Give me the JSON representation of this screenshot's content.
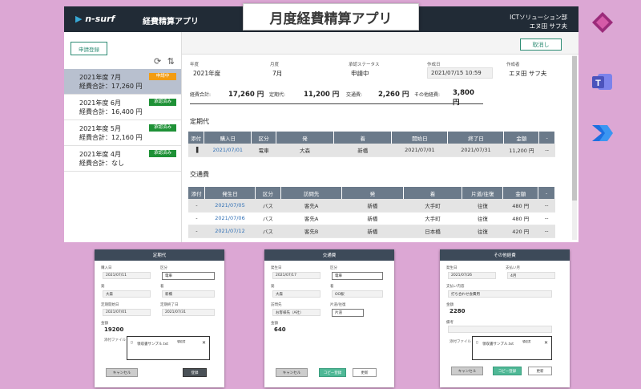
{
  "banner": "月度経費精算アプリ",
  "header": {
    "logo_a": "n-",
    "logo_b": "surf",
    "title": "経費精算アプリ",
    "org": "ICTソリューション部",
    "user": "エヌ田 サフ夫"
  },
  "sidebar": {
    "request_label": "申請登録",
    "refresh": "⟳",
    "sort": "⇅",
    "items": [
      {
        "title": "2021年度 7月",
        "total": "経費合計：17,260 円",
        "badge": "申請中",
        "color": "#f39c12"
      },
      {
        "title": "2021年度 6月",
        "total": "経費合計：16,400 円",
        "badge": "承認済み",
        "color": "#1e9136"
      },
      {
        "title": "2021年度 5月",
        "total": "経費合計：12,160 円",
        "badge": "承認済み",
        "color": "#1e9136"
      },
      {
        "title": "2021年度 4月",
        "total": "経費合計：なし",
        "badge": "承認済み",
        "color": "#1e9136"
      }
    ]
  },
  "detail": {
    "cancel": "取消し",
    "fields": {
      "year_l": "年度",
      "year": "2021年度",
      "month_l": "月度",
      "month": "7月",
      "status_l": "承認ステータス",
      "status": "申請中",
      "created_l": "作成日",
      "created": "2021/07/15 10:59",
      "author_l": "作成者",
      "author": "エヌ田 サフ夫"
    },
    "summary": {
      "total_l": "経費合計:",
      "total": "17,260 円",
      "commuter_l": "定期代:",
      "commuter": "11,200 円",
      "transport_l": "交通費:",
      "transport": "2,260 円",
      "other_l": "その他経費:",
      "other": "3,800 円"
    },
    "commuter_title": "定期代",
    "commuter_cols": [
      "添付",
      "購入日",
      "区分",
      "発",
      "着",
      "開始日",
      "終了日",
      "金額",
      "-"
    ],
    "commuter_rows": [
      [
        "▐",
        "2021/07/01",
        "電車",
        "大森",
        "新橋",
        "2021/07/01",
        "2021/07/31",
        "11,200 円",
        "--"
      ]
    ],
    "transport_title": "交通費",
    "transport_cols": [
      "添付",
      "発生日",
      "区分",
      "訪問先",
      "発",
      "着",
      "片道/往復",
      "金額",
      "-"
    ],
    "transport_rows": [
      [
        "-",
        "2021/07/05",
        "バス",
        "客先A",
        "新橋",
        "大手町",
        "往復",
        "480 円",
        "--"
      ],
      [
        "-",
        "2021/07/06",
        "バス",
        "客先A",
        "新橋",
        "大手町",
        "往復",
        "480 円",
        "--"
      ],
      [
        "-",
        "2021/07/12",
        "バス",
        "客先B",
        "新橋",
        "日本橋",
        "往復",
        "420 円",
        "--"
      ]
    ]
  },
  "dialog1": {
    "title": "定期代",
    "date_l": "購入日",
    "date": "2021/07/11",
    "kind_l": "区分",
    "kind": "電車",
    "from_l": "発",
    "from": "大森",
    "to_l": "着",
    "to": "新橋",
    "start_l": "定期開始日",
    "start": "2021/07/01",
    "end_l": "定期終了日",
    "end": "2021/07/31",
    "amt_l": "金額",
    "amt": "19200",
    "file_l": "添付ファイル",
    "file": "領収書サンプル.txt",
    "file_tag": "領収書",
    "cancel": "キャンセル",
    "save": "登録"
  },
  "dialog2": {
    "title": "交通費",
    "date_l": "発生日",
    "date": "2021/07/17",
    "kind_l": "区分",
    "kind": "電車",
    "from_l": "発",
    "from": "大森",
    "to_l": "着",
    "to": "OO駅",
    "visit_l": "訪問先",
    "visit": "お客様先（A社）",
    "way_l": "片道/往復",
    "way": "片道",
    "amt_l": "金額",
    "amt": "640",
    "cancel": "キャンセル",
    "copy": "コピー登録",
    "update": "更新"
  },
  "dialog3": {
    "title": "その他経費",
    "date_l": "発生日",
    "date": "2021/07/26",
    "pay_l": "支払い月",
    "pay": "4月",
    "content_l": "支払い内容",
    "content": "打ち合わせ会費用",
    "amt_l": "金額",
    "amt": "2280",
    "note_l": "備考",
    "note": "",
    "file_l": "添付ファイル",
    "file": "領収書サンプル.txt",
    "file_tag": "領収書",
    "cancel": "キャンセル",
    "copy": "コピー登録",
    "update": "更新"
  },
  "icons": [
    "power-apps-icon",
    "teams-icon",
    "power-automate-icon"
  ]
}
